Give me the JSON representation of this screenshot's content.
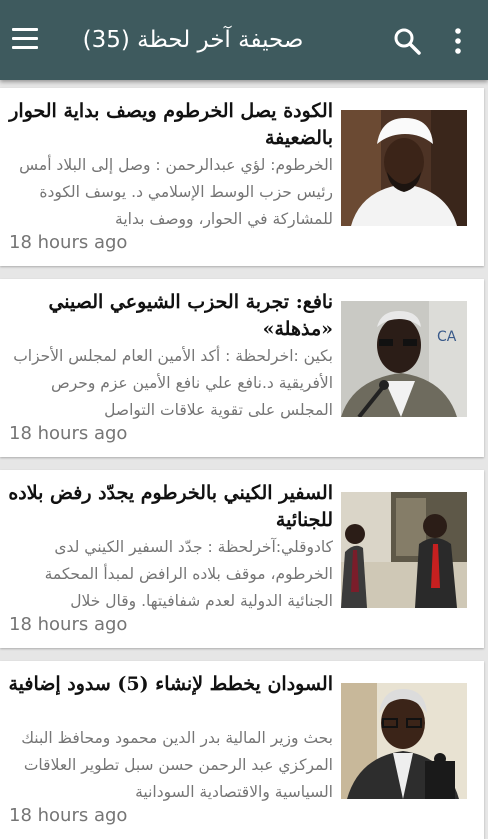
{
  "appbar": {
    "title": "صحيفة آخر لحظة (35)",
    "menu_icon": "hamburger-menu-icon",
    "search_icon": "search-icon",
    "more_icon": "more-vert-icon",
    "color": "#3e5a5e"
  },
  "articles": [
    {
      "headline": "الكودة يصل الخرطوم ويصف بداية الحوار بالضعيفة",
      "excerpt": "الخرطوم: لؤي عبدالرحمن : وصل إلى البلاد أمس رئيس حزب الوسط الإسلامي د. يوسف الكودة للمشاركة في الحوار، ووصف بداية",
      "time": "18 hours ago"
    },
    {
      "headline": "نافع: تجربة الحزب الشيوعي الصيني «مذهلة»",
      "excerpt": "بكين :اخرلحظة : أكد الأمين العام لمجلس الأحزاب الأفريقية د.نافع علي نافع الأمين عزم وحرص المجلس على تقوية علاقات التواصل",
      "time": "18 hours ago"
    },
    {
      "headline": "السفير الكيني بالخرطوم يجدّد رفض بلاده للجنائية",
      "excerpt": "كادوقلي:آخرلحظة : جدّد السفير الكيني لدى الخرطوم، موقف بلاده الرافض لمبدأ المحكمة الجنائية الدولية لعدم شفافيتها. وقال خلال",
      "time": "18 hours ago"
    },
    {
      "headline": "السودان يخطط لإنشاء (5) سدود إضافية",
      "excerpt": "بحث وزير المالية بدر الدين محمود ومحافظ البنك المركزي عبد الرحمن حسن سبل تطوير العلاقات السياسية والاقتصادية السودانية",
      "time": "18 hours ago"
    }
  ]
}
